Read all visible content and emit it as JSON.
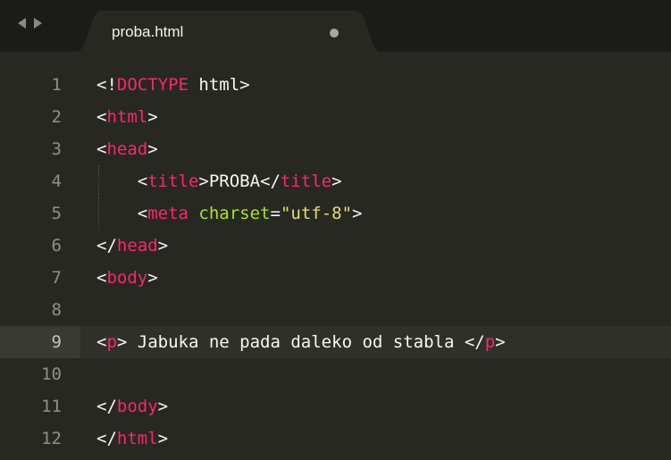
{
  "tab": {
    "filename": "proba.html"
  },
  "colors": {
    "background": "#272822",
    "tab_bar": "#1b1c17",
    "tag": "#f92672",
    "attribute": "#a6e22e",
    "string": "#e6db74",
    "text": "#f8f8f2",
    "line_number": "#8f908a"
  },
  "icons": [
    "arrow-left-icon",
    "arrow-right-icon",
    "unsaved-dot-icon"
  ],
  "editor": {
    "active_line": 9,
    "lines": [
      {
        "number": "1",
        "tokens": [
          {
            "t": "<!",
            "c": "plain"
          },
          {
            "t": "DOCTYPE",
            "c": "tag"
          },
          {
            "t": " html>",
            "c": "plain"
          }
        ]
      },
      {
        "number": "2",
        "tokens": [
          {
            "t": "<",
            "c": "plain"
          },
          {
            "t": "html",
            "c": "tag"
          },
          {
            "t": ">",
            "c": "plain"
          }
        ]
      },
      {
        "number": "3",
        "tokens": [
          {
            "t": "<",
            "c": "plain"
          },
          {
            "t": "head",
            "c": "tag"
          },
          {
            "t": ">",
            "c": "plain"
          }
        ]
      },
      {
        "number": "4",
        "tokens": [
          {
            "t": "    <",
            "c": "plain"
          },
          {
            "t": "title",
            "c": "tag"
          },
          {
            "t": ">PROBA</",
            "c": "plain"
          },
          {
            "t": "title",
            "c": "tag"
          },
          {
            "t": ">",
            "c": "plain"
          }
        ]
      },
      {
        "number": "5",
        "tokens": [
          {
            "t": "    <",
            "c": "plain"
          },
          {
            "t": "meta",
            "c": "tag"
          },
          {
            "t": " ",
            "c": "plain"
          },
          {
            "t": "charset",
            "c": "attr"
          },
          {
            "t": "=",
            "c": "plain"
          },
          {
            "t": "\"utf-8\"",
            "c": "str"
          },
          {
            "t": ">",
            "c": "plain"
          }
        ]
      },
      {
        "number": "6",
        "tokens": [
          {
            "t": "</",
            "c": "plain"
          },
          {
            "t": "head",
            "c": "tag"
          },
          {
            "t": ">",
            "c": "plain"
          }
        ]
      },
      {
        "number": "7",
        "tokens": [
          {
            "t": "<",
            "c": "plain"
          },
          {
            "t": "body",
            "c": "tag"
          },
          {
            "t": ">",
            "c": "plain"
          }
        ]
      },
      {
        "number": "8",
        "tokens": []
      },
      {
        "number": "9",
        "tokens": [
          {
            "t": "<",
            "c": "plain"
          },
          {
            "t": "p",
            "c": "tag"
          },
          {
            "t": "> Jabuka ne pada daleko od stabla </",
            "c": "plain"
          },
          {
            "t": "p",
            "c": "tag"
          },
          {
            "t": ">",
            "c": "plain"
          }
        ]
      },
      {
        "number": "10",
        "tokens": []
      },
      {
        "number": "11",
        "tokens": [
          {
            "t": "</",
            "c": "plain"
          },
          {
            "t": "body",
            "c": "tag"
          },
          {
            "t": ">",
            "c": "plain"
          }
        ]
      },
      {
        "number": "12",
        "tokens": [
          {
            "t": "</",
            "c": "plain"
          },
          {
            "t": "html",
            "c": "tag"
          },
          {
            "t": ">",
            "c": "plain"
          }
        ]
      }
    ]
  }
}
